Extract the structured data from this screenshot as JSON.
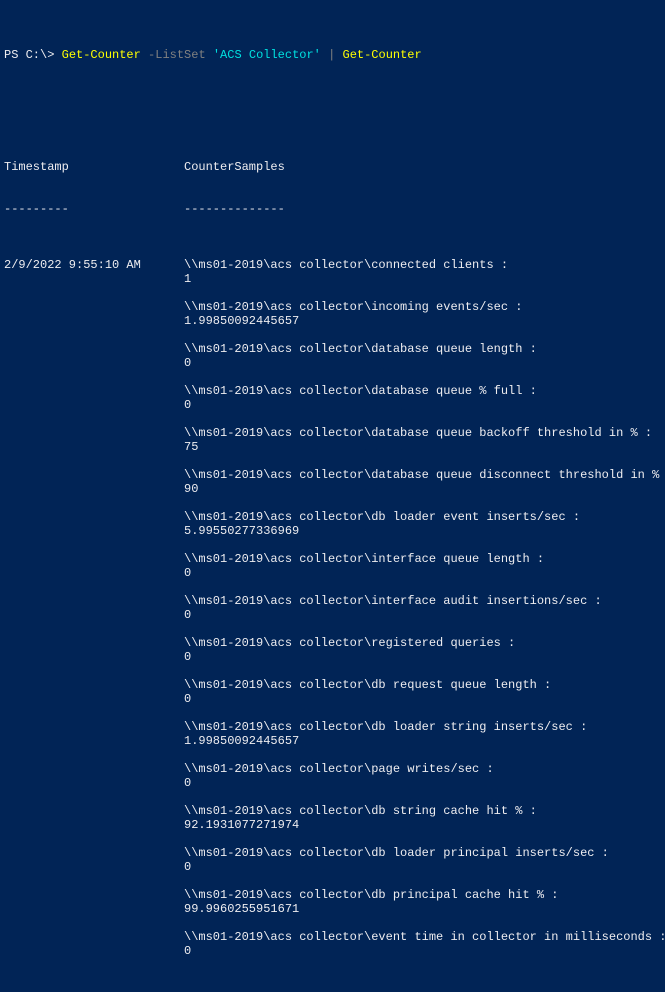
{
  "prompt": {
    "ps": "PS",
    "path": "C:\\>",
    "cmd1": "Get-Counter",
    "param": "-ListSet",
    "arg": "'ACS Collector'",
    "pipe": "|",
    "cmd2": "Get-Counter"
  },
  "headers": {
    "timestamp": "Timestamp",
    "counterSamples": "CounterSamples",
    "tsDash": "---------",
    "csDash": "--------------"
  },
  "timestamp": "2/9/2022 9:55:10 AM",
  "samples": [
    {
      "path": "\\\\ms01-2019\\acs collector\\connected clients :",
      "value": "1"
    },
    {
      "path": "\\\\ms01-2019\\acs collector\\incoming events/sec :",
      "value": "1.99850092445657"
    },
    {
      "path": "\\\\ms01-2019\\acs collector\\database queue length :",
      "value": "0"
    },
    {
      "path": "\\\\ms01-2019\\acs collector\\database queue % full :",
      "value": "0"
    },
    {
      "path": "\\\\ms01-2019\\acs collector\\database queue backoff threshold in % :",
      "value": "75"
    },
    {
      "path": "\\\\ms01-2019\\acs collector\\database queue disconnect threshold in % :",
      "value": "90"
    },
    {
      "path": "\\\\ms01-2019\\acs collector\\db loader event inserts/sec :",
      "value": "5.99550277336969"
    },
    {
      "path": "\\\\ms01-2019\\acs collector\\interface queue length :",
      "value": "0"
    },
    {
      "path": "\\\\ms01-2019\\acs collector\\interface audit insertions/sec :",
      "value": "0"
    },
    {
      "path": "\\\\ms01-2019\\acs collector\\registered queries :",
      "value": "0"
    },
    {
      "path": "\\\\ms01-2019\\acs collector\\db request queue length :",
      "value": "0"
    },
    {
      "path": "\\\\ms01-2019\\acs collector\\db loader string inserts/sec :",
      "value": "1.99850092445657"
    },
    {
      "path": "\\\\ms01-2019\\acs collector\\page writes/sec :",
      "value": "0"
    },
    {
      "path": "\\\\ms01-2019\\acs collector\\db string cache hit % :",
      "value": "92.1931077271974"
    },
    {
      "path": "\\\\ms01-2019\\acs collector\\db loader principal inserts/sec :",
      "value": "0"
    },
    {
      "path": "\\\\ms01-2019\\acs collector\\db principal cache hit % :",
      "value": "99.9960255951671"
    },
    {
      "path": "\\\\ms01-2019\\acs collector\\event time in collector in milliseconds :",
      "value": "0"
    }
  ]
}
